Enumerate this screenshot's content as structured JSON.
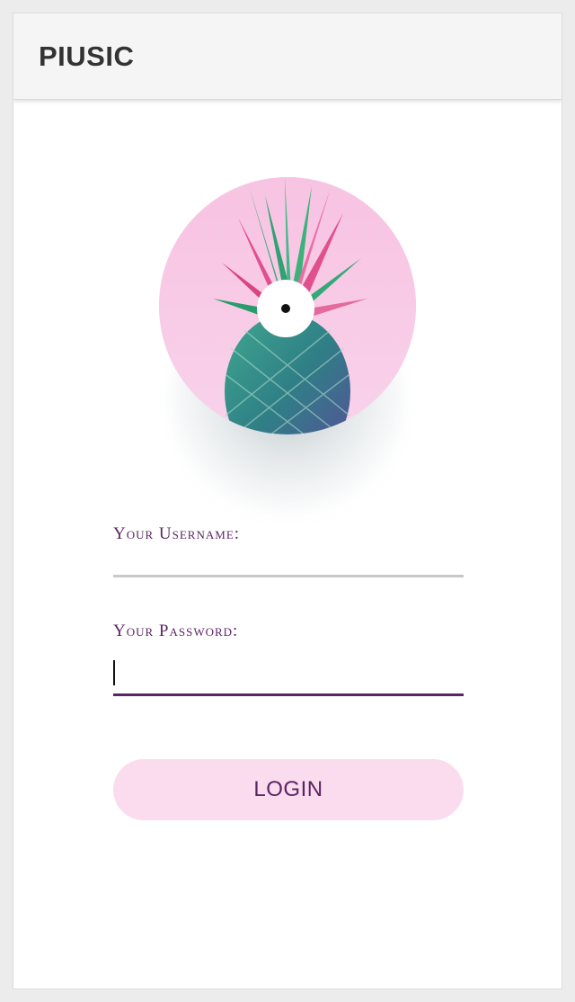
{
  "app": {
    "title": "PIUSIC"
  },
  "logo": {
    "icon": "vinyl-pineapple-logo",
    "disc_color": "#f8c6e4",
    "center_color": "#ffffff"
  },
  "form": {
    "username": {
      "label": "Your Username:",
      "value": "",
      "underline_color": "#c8c8c8"
    },
    "password": {
      "label": "Your Password:",
      "value": "",
      "focused": true,
      "underline_color": "#5a2563"
    },
    "login_button": {
      "label": "LOGIN",
      "background": "#fbdcef",
      "text_color": "#5a2563"
    }
  },
  "colors": {
    "accent": "#5a2563",
    "app_bar": "#f5f5f5",
    "title_text": "#333333"
  }
}
